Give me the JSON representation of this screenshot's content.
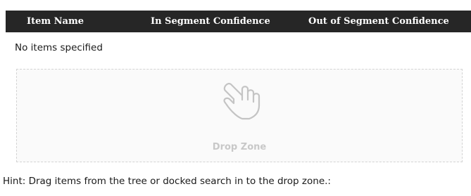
{
  "table": {
    "columns": [
      "Item Name",
      "In Segment Confidence",
      "Out of Segment Confidence"
    ],
    "empty_message": "No items specified"
  },
  "dropzone": {
    "icon": "hand-pointer-icon",
    "label": "Drop Zone"
  },
  "hint": "Hint: Drag items from the tree or docked search in to the drop zone.:",
  "colors": {
    "header_bg": "#262626",
    "header_text": "#ffffff",
    "dropzone_label": "#c8c8c8",
    "dropzone_border": "#d4d4d4"
  }
}
